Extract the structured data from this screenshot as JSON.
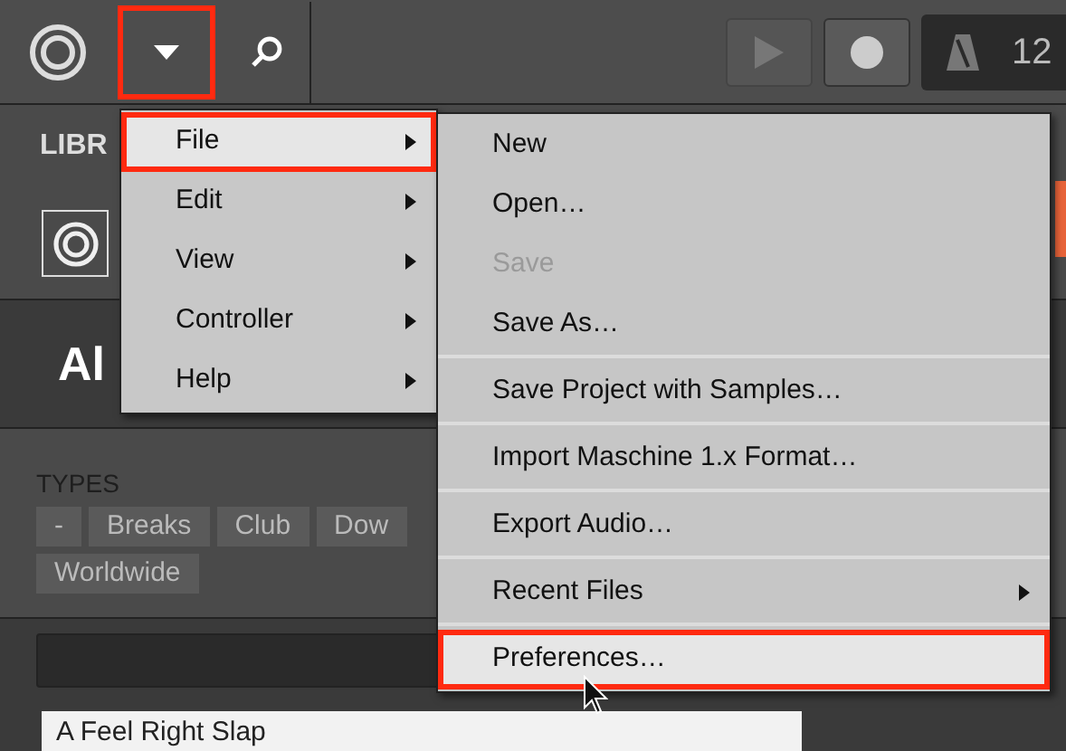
{
  "toolbar": {
    "menu_button": {
      "annotated": true
    },
    "transport_reading": "12"
  },
  "library": {
    "tab_label": "LIBR",
    "heading": "Al",
    "types_label": "TYPES",
    "tags": [
      {
        "label": "-"
      },
      {
        "label": "Breaks"
      },
      {
        "label": "Club"
      },
      {
        "label": "Dow"
      },
      {
        "label": "Worldwide"
      }
    ],
    "results": [
      "A Feel Right Slap"
    ]
  },
  "main_menu": [
    {
      "label": "File",
      "has_submenu": true,
      "selected": true,
      "annotated": true
    },
    {
      "label": "Edit",
      "has_submenu": true,
      "selected": false,
      "annotated": false
    },
    {
      "label": "View",
      "has_submenu": true,
      "selected": false,
      "annotated": false
    },
    {
      "label": "Controller",
      "has_submenu": true,
      "selected": false,
      "annotated": false
    },
    {
      "label": "Help",
      "has_submenu": true,
      "selected": false,
      "annotated": false
    }
  ],
  "file_menu": [
    {
      "label": "New",
      "divider_above": false,
      "disabled": false,
      "has_submenu": false,
      "selected": false,
      "annotated": false
    },
    {
      "label": "Open…",
      "divider_above": false,
      "disabled": false,
      "has_submenu": false,
      "selected": false,
      "annotated": false
    },
    {
      "label": "Save",
      "divider_above": false,
      "disabled": true,
      "has_submenu": false,
      "selected": false,
      "annotated": false
    },
    {
      "label": "Save As…",
      "divider_above": false,
      "disabled": false,
      "has_submenu": false,
      "selected": false,
      "annotated": false
    },
    {
      "label": "Save Project with Samples…",
      "divider_above": true,
      "disabled": false,
      "has_submenu": false,
      "selected": false,
      "annotated": false
    },
    {
      "label": "Import Maschine 1.x Format…",
      "divider_above": true,
      "disabled": false,
      "has_submenu": false,
      "selected": false,
      "annotated": false
    },
    {
      "label": "Export Audio…",
      "divider_above": true,
      "disabled": false,
      "has_submenu": false,
      "selected": false,
      "annotated": false
    },
    {
      "label": "Recent Files",
      "divider_above": true,
      "disabled": false,
      "has_submenu": true,
      "selected": false,
      "annotated": false
    },
    {
      "label": "Preferences…",
      "divider_above": true,
      "disabled": false,
      "has_submenu": false,
      "selected": true,
      "annotated": true
    }
  ]
}
